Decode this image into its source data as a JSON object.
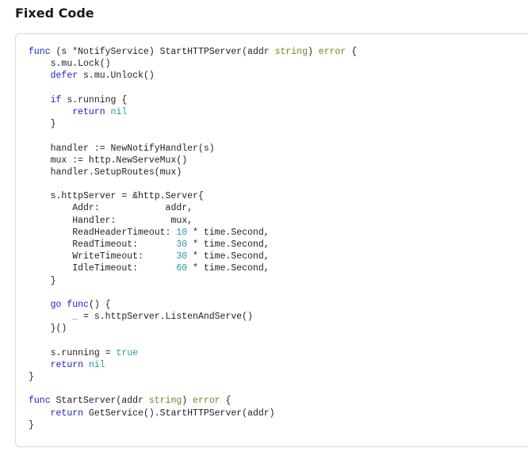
{
  "heading": "Fixed Code",
  "colors": {
    "keyword": "#1a22c8",
    "type": "#5d8c1e",
    "literal": "#1f9aa6",
    "text": "#1f1f1f"
  },
  "code": {
    "lines": [
      [
        {
          "t": "func",
          "c": "kw"
        },
        {
          "t": " (s *NotifyService) StartHTTPServer(addr "
        },
        {
          "t": "string",
          "c": "ty"
        },
        {
          "t": ") "
        },
        {
          "t": "error",
          "c": "ty"
        },
        {
          "t": " {"
        }
      ],
      [
        {
          "t": "\ts.mu.Lock()"
        }
      ],
      [
        {
          "t": "\t"
        },
        {
          "t": "defer",
          "c": "kw"
        },
        {
          "t": " s.mu.Unlock()"
        }
      ],
      [],
      [
        {
          "t": "\t"
        },
        {
          "t": "if",
          "c": "kw"
        },
        {
          "t": " s.running {"
        }
      ],
      [
        {
          "t": "\t\t"
        },
        {
          "t": "return",
          "c": "kw"
        },
        {
          "t": " "
        },
        {
          "t": "nil",
          "c": "lit"
        }
      ],
      [
        {
          "t": "\t}"
        }
      ],
      [],
      [
        {
          "t": "\thandler := NewNotifyHandler(s)"
        }
      ],
      [
        {
          "t": "\tmux := http.NewServeMux()"
        }
      ],
      [
        {
          "t": "\thandler.SetupRoutes(mux)"
        }
      ],
      [],
      [
        {
          "t": "\ts.httpServer = &http.Server{"
        }
      ],
      [
        {
          "t": "\t\tAddr:            addr,"
        }
      ],
      [
        {
          "t": "\t\tHandler:          mux,"
        }
      ],
      [
        {
          "t": "\t\tReadHeaderTimeout: "
        },
        {
          "t": "10",
          "c": "lit"
        },
        {
          "t": " * time.Second,"
        }
      ],
      [
        {
          "t": "\t\tReadTimeout:       "
        },
        {
          "t": "30",
          "c": "lit"
        },
        {
          "t": " * time.Second,"
        }
      ],
      [
        {
          "t": "\t\tWriteTimeout:      "
        },
        {
          "t": "30",
          "c": "lit"
        },
        {
          "t": " * time.Second,"
        }
      ],
      [
        {
          "t": "\t\tIdleTimeout:       "
        },
        {
          "t": "60",
          "c": "lit"
        },
        {
          "t": " * time.Second,"
        }
      ],
      [
        {
          "t": "\t}"
        }
      ],
      [],
      [
        {
          "t": "\t"
        },
        {
          "t": "go",
          "c": "kw"
        },
        {
          "t": " "
        },
        {
          "t": "func",
          "c": "kw"
        },
        {
          "t": "() {"
        }
      ],
      [
        {
          "t": "\t\t"
        },
        {
          "t": "_",
          "c": "lit"
        },
        {
          "t": " = s.httpServer.ListenAndServe()"
        }
      ],
      [
        {
          "t": "\t}()"
        }
      ],
      [],
      [
        {
          "t": "\ts.running = "
        },
        {
          "t": "true",
          "c": "lit"
        }
      ],
      [
        {
          "t": "\t"
        },
        {
          "t": "return",
          "c": "kw"
        },
        {
          "t": " "
        },
        {
          "t": "nil",
          "c": "lit"
        }
      ],
      [
        {
          "t": "}"
        }
      ],
      [],
      [
        {
          "t": "func",
          "c": "kw"
        },
        {
          "t": " StartServer(addr "
        },
        {
          "t": "string",
          "c": "ty"
        },
        {
          "t": ") "
        },
        {
          "t": "error",
          "c": "ty"
        },
        {
          "t": " {"
        }
      ],
      [
        {
          "t": "\t"
        },
        {
          "t": "return",
          "c": "kw"
        },
        {
          "t": " GetService().StartHTTPServer(addr)"
        }
      ],
      [
        {
          "t": "}"
        }
      ]
    ]
  }
}
